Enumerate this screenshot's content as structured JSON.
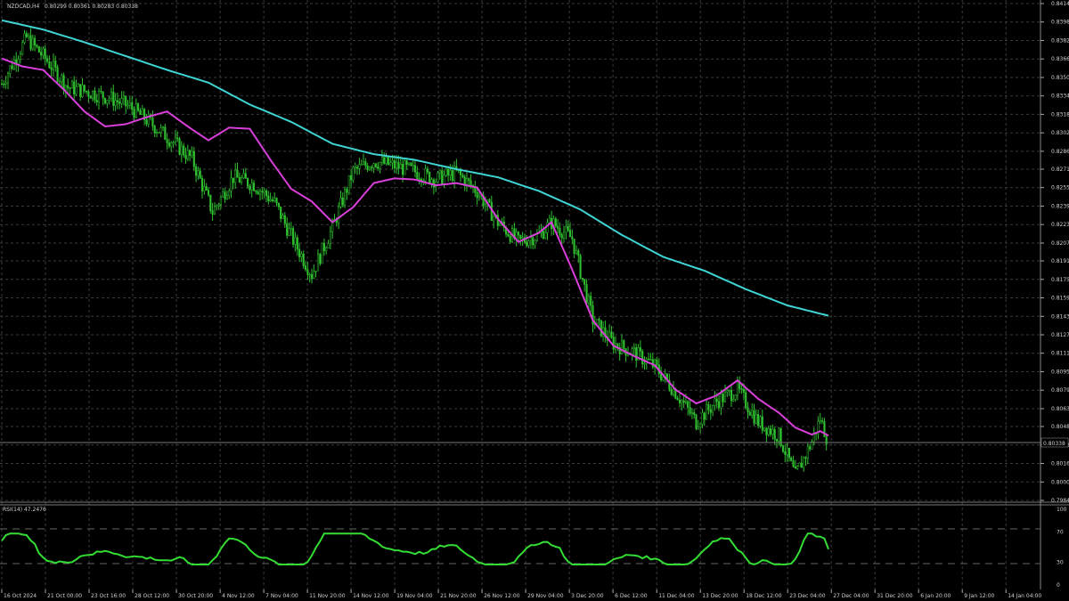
{
  "header": {
    "symbol": "NZDCAD,H4",
    "ohlc": "0.80299 0.80361 0.80283 0.80338"
  },
  "rsi_header": {
    "label": "RSI(14) 47.2476"
  },
  "colors": {
    "background": "#000000",
    "candle": "#2fbf2f",
    "ma_fast": "#d93fd9",
    "ma_slow": "#3fd4d4",
    "rsi_line": "#33dd33",
    "grid": "#3a3a3a"
  },
  "chart_data": [
    {
      "type": "line",
      "title": "NZDCAD,H4",
      "series": [
        {
          "values_description": "candles"
        },
        {
          "values_description": "fast moving average"
        },
        {
          "values_description": "slow moving average"
        }
      ],
      "price_axis_labels": [
        "0.84145",
        "0.83985",
        "0.83825",
        "0.83665",
        "0.83505",
        "0.83345",
        "0.83185",
        "0.83025",
        "0.82865",
        "0.82710",
        "0.82550",
        "0.82390",
        "0.82230",
        "0.82070",
        "0.81915",
        "0.81755",
        "0.81595",
        "0.81435",
        "0.81275",
        "0.81115",
        "0.80955",
        "0.80795",
        "0.80635",
        "0.80480",
        "0.80320",
        "0.80160",
        "0.80000",
        "0.79840"
      ],
      "current_price": "0.80338",
      "x_labels": [
        "16 Oct 2024",
        "21 Oct 00:00",
        "23 Oct 16:00",
        "28 Oct 12:00",
        "30 Oct 20:00",
        "4 Nov 12:00",
        "7 Nov 04:00",
        "11 Nov 20:00",
        "14 Nov 12:00",
        "19 Nov 04:00",
        "21 Nov 20:00",
        "26 Nov 12:00",
        "29 Nov 04:00",
        "3 Dec 20:00",
        "6 Dec 12:00",
        "11 Dec 04:00",
        "13 Dec 20:00",
        "18 Dec 12:00",
        "23 Dec 04:00",
        "27 Dec 04:00",
        "31 Dec 20:00",
        "6 Jan 20:00",
        "9 Jan 12:00",
        "14 Jan 04:00"
      ],
      "ylim": [
        0.7984,
        0.84145
      ],
      "grid": true,
      "trend_points": {
        "price_path": [
          [
            0,
            0.8345
          ],
          [
            12,
            0.8385
          ],
          [
            22,
            0.8365
          ],
          [
            32,
            0.8342
          ],
          [
            42,
            0.8338
          ],
          [
            52,
            0.8333
          ],
          [
            62,
            0.8325
          ],
          [
            72,
            0.8311
          ],
          [
            82,
            0.8296
          ],
          [
            92,
            0.828
          ],
          [
            102,
            0.8234
          ],
          [
            112,
            0.8264
          ],
          [
            122,
            0.8258
          ],
          [
            132,
            0.8242
          ],
          [
            142,
            0.8206
          ],
          [
            150,
            0.818
          ],
          [
            160,
            0.822
          ],
          [
            170,
            0.8269
          ],
          [
            180,
            0.8278
          ],
          [
            190,
            0.8274
          ],
          [
            200,
            0.8269
          ],
          [
            210,
            0.8262
          ],
          [
            220,
            0.8268
          ],
          [
            230,
            0.8252
          ],
          [
            240,
            0.8225
          ],
          [
            250,
            0.8208
          ],
          [
            260,
            0.8214
          ],
          [
            266,
            0.8225
          ],
          [
            276,
            0.8211
          ],
          [
            286,
            0.814
          ],
          [
            296,
            0.812
          ],
          [
            306,
            0.8112
          ],
          [
            316,
            0.81
          ],
          [
            326,
            0.8078
          ],
          [
            336,
            0.8052
          ],
          [
            346,
            0.807
          ],
          [
            356,
            0.808
          ],
          [
            366,
            0.8052
          ],
          [
            376,
            0.804
          ],
          [
            384,
            0.8005
          ],
          [
            392,
            0.8035
          ],
          [
            396,
            0.8055
          ],
          [
            400,
            0.8034
          ]
        ],
        "ma_fast_path": [
          [
            0,
            0.8367
          ],
          [
            10,
            0.836
          ],
          [
            20,
            0.8357
          ],
          [
            30,
            0.834
          ],
          [
            40,
            0.8321
          ],
          [
            50,
            0.8308
          ],
          [
            60,
            0.831
          ],
          [
            70,
            0.8316
          ],
          [
            80,
            0.8321
          ],
          [
            90,
            0.8308
          ],
          [
            100,
            0.8296
          ],
          [
            110,
            0.8307
          ],
          [
            120,
            0.8306
          ],
          [
            130,
            0.8279
          ],
          [
            140,
            0.8254
          ],
          [
            150,
            0.8243
          ],
          [
            160,
            0.8225
          ],
          [
            170,
            0.8238
          ],
          [
            180,
            0.8259
          ],
          [
            190,
            0.8263
          ],
          [
            200,
            0.8262
          ],
          [
            210,
            0.8257
          ],
          [
            220,
            0.8259
          ],
          [
            230,
            0.8255
          ],
          [
            240,
            0.8228
          ],
          [
            250,
            0.8208
          ],
          [
            260,
            0.8216
          ],
          [
            266,
            0.8225
          ],
          [
            276,
            0.8184
          ],
          [
            286,
            0.814
          ],
          [
            296,
            0.8118
          ],
          [
            306,
            0.8109
          ],
          [
            316,
            0.8101
          ],
          [
            326,
            0.808
          ],
          [
            336,
            0.8068
          ],
          [
            346,
            0.8075
          ],
          [
            356,
            0.8088
          ],
          [
            366,
            0.8072
          ],
          [
            376,
            0.806
          ],
          [
            384,
            0.8047
          ],
          [
            392,
            0.8041
          ],
          [
            396,
            0.8044
          ],
          [
            400,
            0.804
          ]
        ],
        "ma_slow_path": [
          [
            0,
            0.84
          ],
          [
            20,
            0.8392
          ],
          [
            40,
            0.8381
          ],
          [
            60,
            0.8369
          ],
          [
            80,
            0.8357
          ],
          [
            100,
            0.8346
          ],
          [
            120,
            0.8327
          ],
          [
            140,
            0.8312
          ],
          [
            160,
            0.8293
          ],
          [
            180,
            0.8284
          ],
          [
            200,
            0.8279
          ],
          [
            220,
            0.8271
          ],
          [
            240,
            0.8264
          ],
          [
            260,
            0.8252
          ],
          [
            280,
            0.8236
          ],
          [
            300,
            0.8214
          ],
          [
            320,
            0.8195
          ],
          [
            340,
            0.8183
          ],
          [
            360,
            0.8167
          ],
          [
            380,
            0.8153
          ],
          [
            400,
            0.8144
          ]
        ]
      }
    },
    {
      "type": "line",
      "title": "RSI(14) 47.2476",
      "axis_labels": [
        "100",
        "70",
        "30",
        "0"
      ],
      "levels": [
        70,
        30
      ],
      "ylim": [
        0,
        100
      ],
      "grid": true
    }
  ]
}
